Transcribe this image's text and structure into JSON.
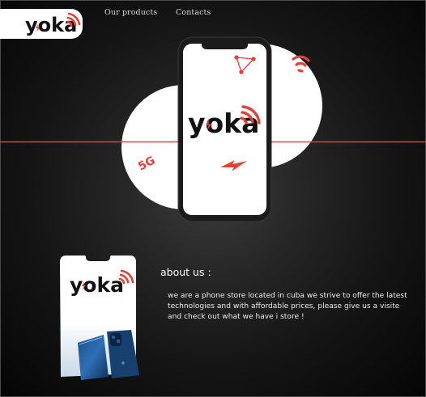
{
  "brand": {
    "logo_text": "yoka",
    "accent_color": "#e2413a"
  },
  "nav": {
    "items": [
      {
        "label": "Our products"
      },
      {
        "label": "Contacts"
      }
    ]
  },
  "hero": {
    "phone_logo_text": "yoka",
    "badge_5g": "5G",
    "icons": [
      "triangle-network-icon",
      "wifi-signal-icon",
      "lightning-icon",
      "5g-badge"
    ]
  },
  "about": {
    "title": "about us :",
    "card_logo_text": "yoka",
    "text": "we are a phone store located in cuba we strive to offer the latest technologies and with affordable prices, please give us a visite and check out what we have i store !"
  }
}
